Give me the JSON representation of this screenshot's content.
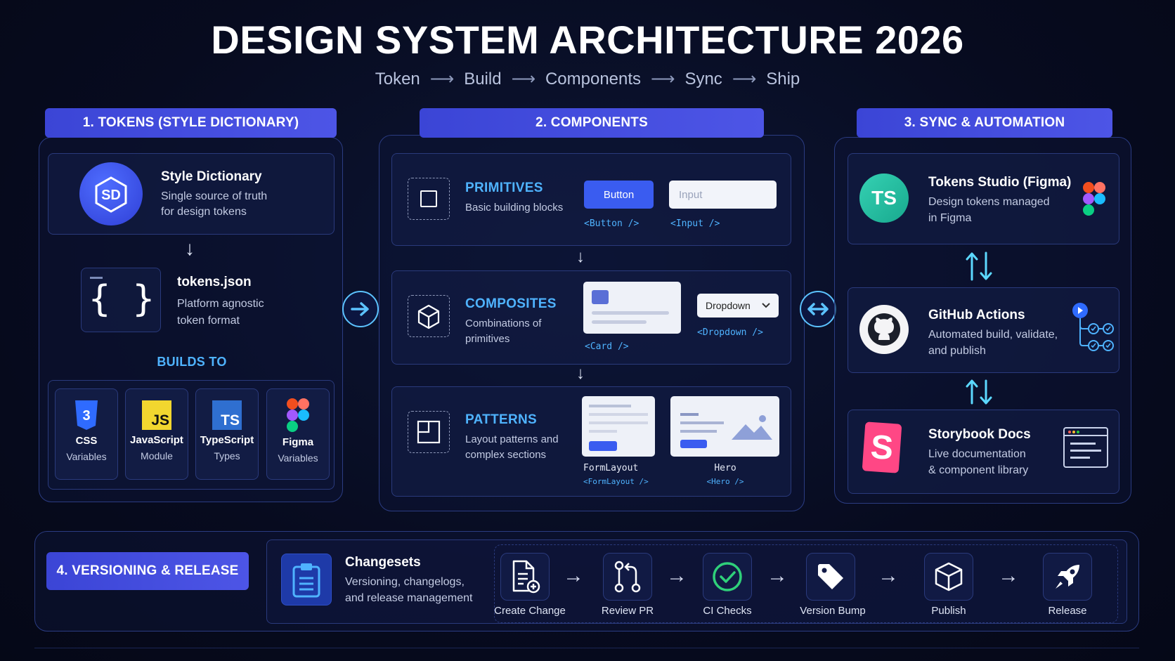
{
  "title": "DESIGN SYSTEM ARCHITECTURE 2026",
  "pipeline": [
    "Token",
    "Build",
    "Components",
    "Sync",
    "Ship"
  ],
  "tokens": {
    "header": "1. TOKENS (STYLE DICTIONARY)",
    "style_dictionary": {
      "title": "Style Dictionary",
      "desc1": "Single source of truth",
      "desc2": "for design tokens"
    },
    "tokens_json": {
      "title": "tokens.json",
      "desc1": "Platform agnostic",
      "desc2": "token format"
    },
    "builds_to": "BUILDS TO",
    "outputs": [
      {
        "name": "CSS",
        "sub": "Variables"
      },
      {
        "name": "JavaScript",
        "sub": "Module"
      },
      {
        "name": "TypeScript",
        "sub": "Types"
      },
      {
        "name": "Figma",
        "sub": "Variables"
      }
    ]
  },
  "components": {
    "header": "2. COMPONENTS",
    "primitives": {
      "title": "PRIMITIVES",
      "desc": "Basic building blocks",
      "button_label": "Button",
      "input_placeholder": "Input",
      "button_tag": "<Button />",
      "input_tag": "<Input />"
    },
    "composites": {
      "title": "COMPOSITES",
      "desc1": "Combinations of",
      "desc2": "primitives",
      "card_tag": "<Card />",
      "dropdown_label": "Dropdown",
      "dropdown_tag": "<Dropdown />"
    },
    "patterns": {
      "title": "PATTERNS",
      "desc1": "Layout patterns and",
      "desc2": "complex sections",
      "form_name": "FormLayout",
      "form_tag": "<FormLayout />",
      "hero_name": "Hero",
      "hero_tag": "<Hero />"
    }
  },
  "sync": {
    "header": "3. SYNC & AUTOMATION",
    "tokens_studio": {
      "badge": "TS",
      "title": "Tokens Studio (Figma)",
      "desc1": "Design tokens managed",
      "desc2": "in Figma"
    },
    "github": {
      "title": "GitHub Actions",
      "desc1": "Automated build, validate,",
      "desc2": "and publish"
    },
    "storybook": {
      "title": "Storybook Docs",
      "desc1": "Live documentation",
      "desc2": "& component library"
    }
  },
  "versioning": {
    "header": "4. VERSIONING & RELEASE",
    "changesets": {
      "title": "Changesets",
      "desc1": "Versioning, changelogs,",
      "desc2": "and release management"
    },
    "steps": [
      "Create Change",
      "Review PR",
      "CI Checks",
      "Version Bump",
      "Publish",
      "Release"
    ]
  },
  "colors": {
    "accent": "#4d55e6",
    "cyan": "#4fb3ff",
    "green": "#2fd07a"
  }
}
